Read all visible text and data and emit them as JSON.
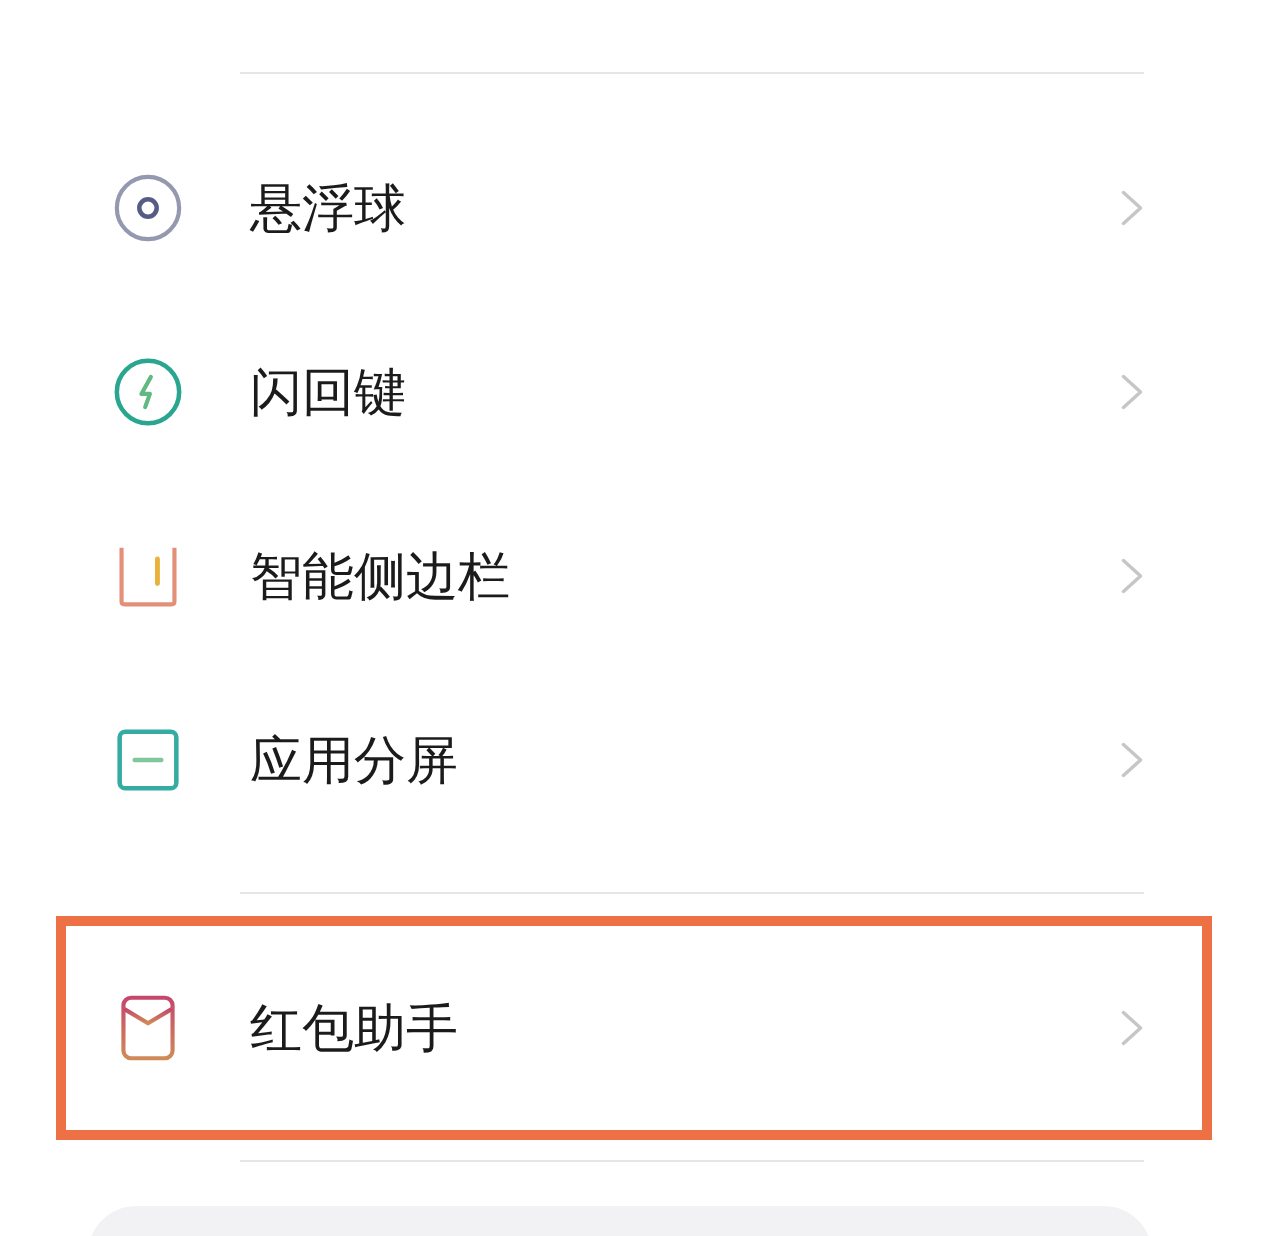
{
  "groups": [
    {
      "items": [
        {
          "label": "悬浮球",
          "highlighted": false
        },
        {
          "label": "闪回键",
          "highlighted": false
        },
        {
          "label": "智能侧边栏",
          "highlighted": false
        },
        {
          "label": "应用分屏",
          "highlighted": false
        }
      ]
    },
    {
      "items": [
        {
          "label": "红包助手",
          "highlighted": true
        }
      ]
    }
  ]
}
